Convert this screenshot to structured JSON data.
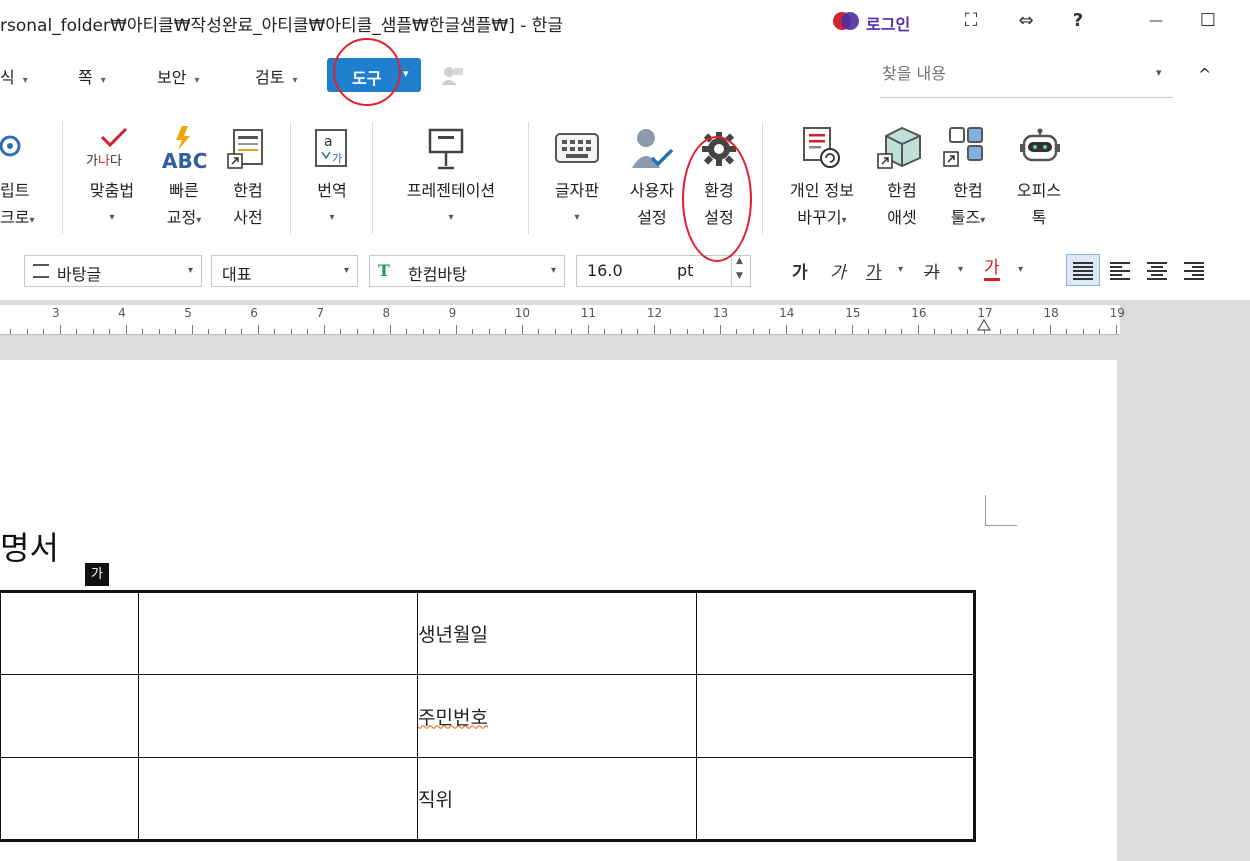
{
  "window": {
    "title": "rsonal_folder₩아티클₩작성완료_아티클₩아티클_샘플₩한글샘플₩] - 한글",
    "login_label": "로그인",
    "buttons": {
      "fullscreen": "⛶",
      "split": "⇔",
      "help": "?",
      "minimize": "—",
      "maximize": "☐"
    }
  },
  "menu": {
    "items": [
      {
        "label": "식"
      },
      {
        "label": "쪽"
      },
      {
        "label": "보안"
      },
      {
        "label": "검토"
      }
    ],
    "active_label": "도구",
    "search_placeholder": "찾을 내용",
    "collapse": "^"
  },
  "ribbon": {
    "partial_group": {
      "line1": "립트",
      "line2": "크로"
    },
    "groups": [
      {
        "id": "spellcheck",
        "line1": "맞춤법",
        "line2": ""
      },
      {
        "id": "quickfix",
        "line1": "빠른",
        "line2": "교정"
      },
      {
        "id": "dictionary",
        "line1": "한컴",
        "line2": "사전"
      },
      {
        "id": "translate",
        "line1": "번역",
        "line2": ""
      },
      {
        "id": "presentation",
        "line1": "프레젠테이션",
        "line2": ""
      },
      {
        "id": "keyboard",
        "line1": "글자판",
        "line2": ""
      },
      {
        "id": "user-settings",
        "line1": "사용자",
        "line2": "설정"
      },
      {
        "id": "preferences",
        "line1": "환경",
        "line2": "설정"
      },
      {
        "id": "privacy",
        "line1": "개인 정보",
        "line2": "바꾸기"
      },
      {
        "id": "hancom-assets",
        "line1": "한컴",
        "line2": "애셋"
      },
      {
        "id": "hancom-tools",
        "line1": "한컴",
        "line2": "툴즈"
      },
      {
        "id": "office-talk",
        "line1": "오피스",
        "line2": "톡"
      }
    ],
    "icon_text": {
      "spell": "가나다",
      "abc": "ABC",
      "translate_a": "a",
      "translate_ga": "가"
    }
  },
  "format_bar": {
    "style": "바탕글",
    "representative": "대표",
    "font": "한컴바탕",
    "font_size": "16.0",
    "unit": "pt",
    "bold": "가",
    "italic": "가",
    "underline": "가",
    "strike": "가",
    "color": "가"
  },
  "ruler": {
    "labels": [
      "3",
      "4",
      "5",
      "6",
      "7",
      "8",
      "9",
      "10",
      "11",
      "12",
      "13",
      "14",
      "15",
      "16",
      "17",
      "18",
      "19"
    ]
  },
  "document": {
    "title": "명서",
    "badge": "가",
    "rows": [
      {
        "label": "생년월일"
      },
      {
        "label": "주민번호"
      },
      {
        "label": "직위"
      }
    ]
  }
}
